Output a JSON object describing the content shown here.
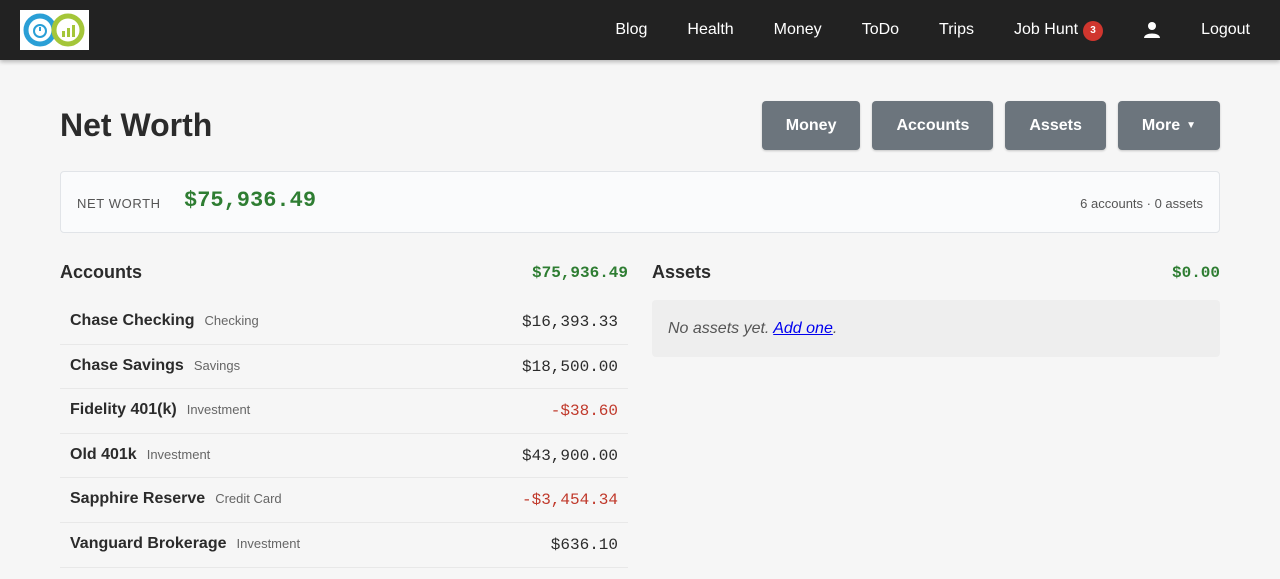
{
  "nav": {
    "links": [
      "Blog",
      "Health",
      "Money",
      "ToDo",
      "Trips"
    ],
    "job_hunt_label": "Job Hunt",
    "job_hunt_badge": "3",
    "logout_label": "Logout"
  },
  "header": {
    "title": "Net Worth",
    "buttons": {
      "money": "Money",
      "accounts": "Accounts",
      "assets": "Assets",
      "more": "More"
    }
  },
  "summary": {
    "label": "NET WORTH",
    "value": "$75,936.49",
    "meta": "6 accounts · 0 assets"
  },
  "accounts": {
    "title": "Accounts",
    "total": "$75,936.49",
    "items": [
      {
        "name": "Chase Checking",
        "type": "Checking",
        "amount": "$16,393.33",
        "negative": false
      },
      {
        "name": "Chase Savings",
        "type": "Savings",
        "amount": "$18,500.00",
        "negative": false
      },
      {
        "name": "Fidelity 401(k)",
        "type": "Investment",
        "amount": "-$38.60",
        "negative": true
      },
      {
        "name": "Old 401k",
        "type": "Investment",
        "amount": "$43,900.00",
        "negative": false
      },
      {
        "name": "Sapphire Reserve",
        "type": "Credit Card",
        "amount": "-$3,454.34",
        "negative": true
      },
      {
        "name": "Vanguard Brokerage",
        "type": "Investment",
        "amount": "$636.10",
        "negative": false
      }
    ]
  },
  "assets": {
    "title": "Assets",
    "total": "$0.00",
    "empty_text": "No assets yet.",
    "add_link": "Add one",
    "empty_suffix": "."
  },
  "colors": {
    "navbar_bg": "#222222",
    "positive": "#2e7d32",
    "negative": "#c0392b",
    "button_bg": "#6c757d",
    "badge_bg": "#d0362e"
  }
}
